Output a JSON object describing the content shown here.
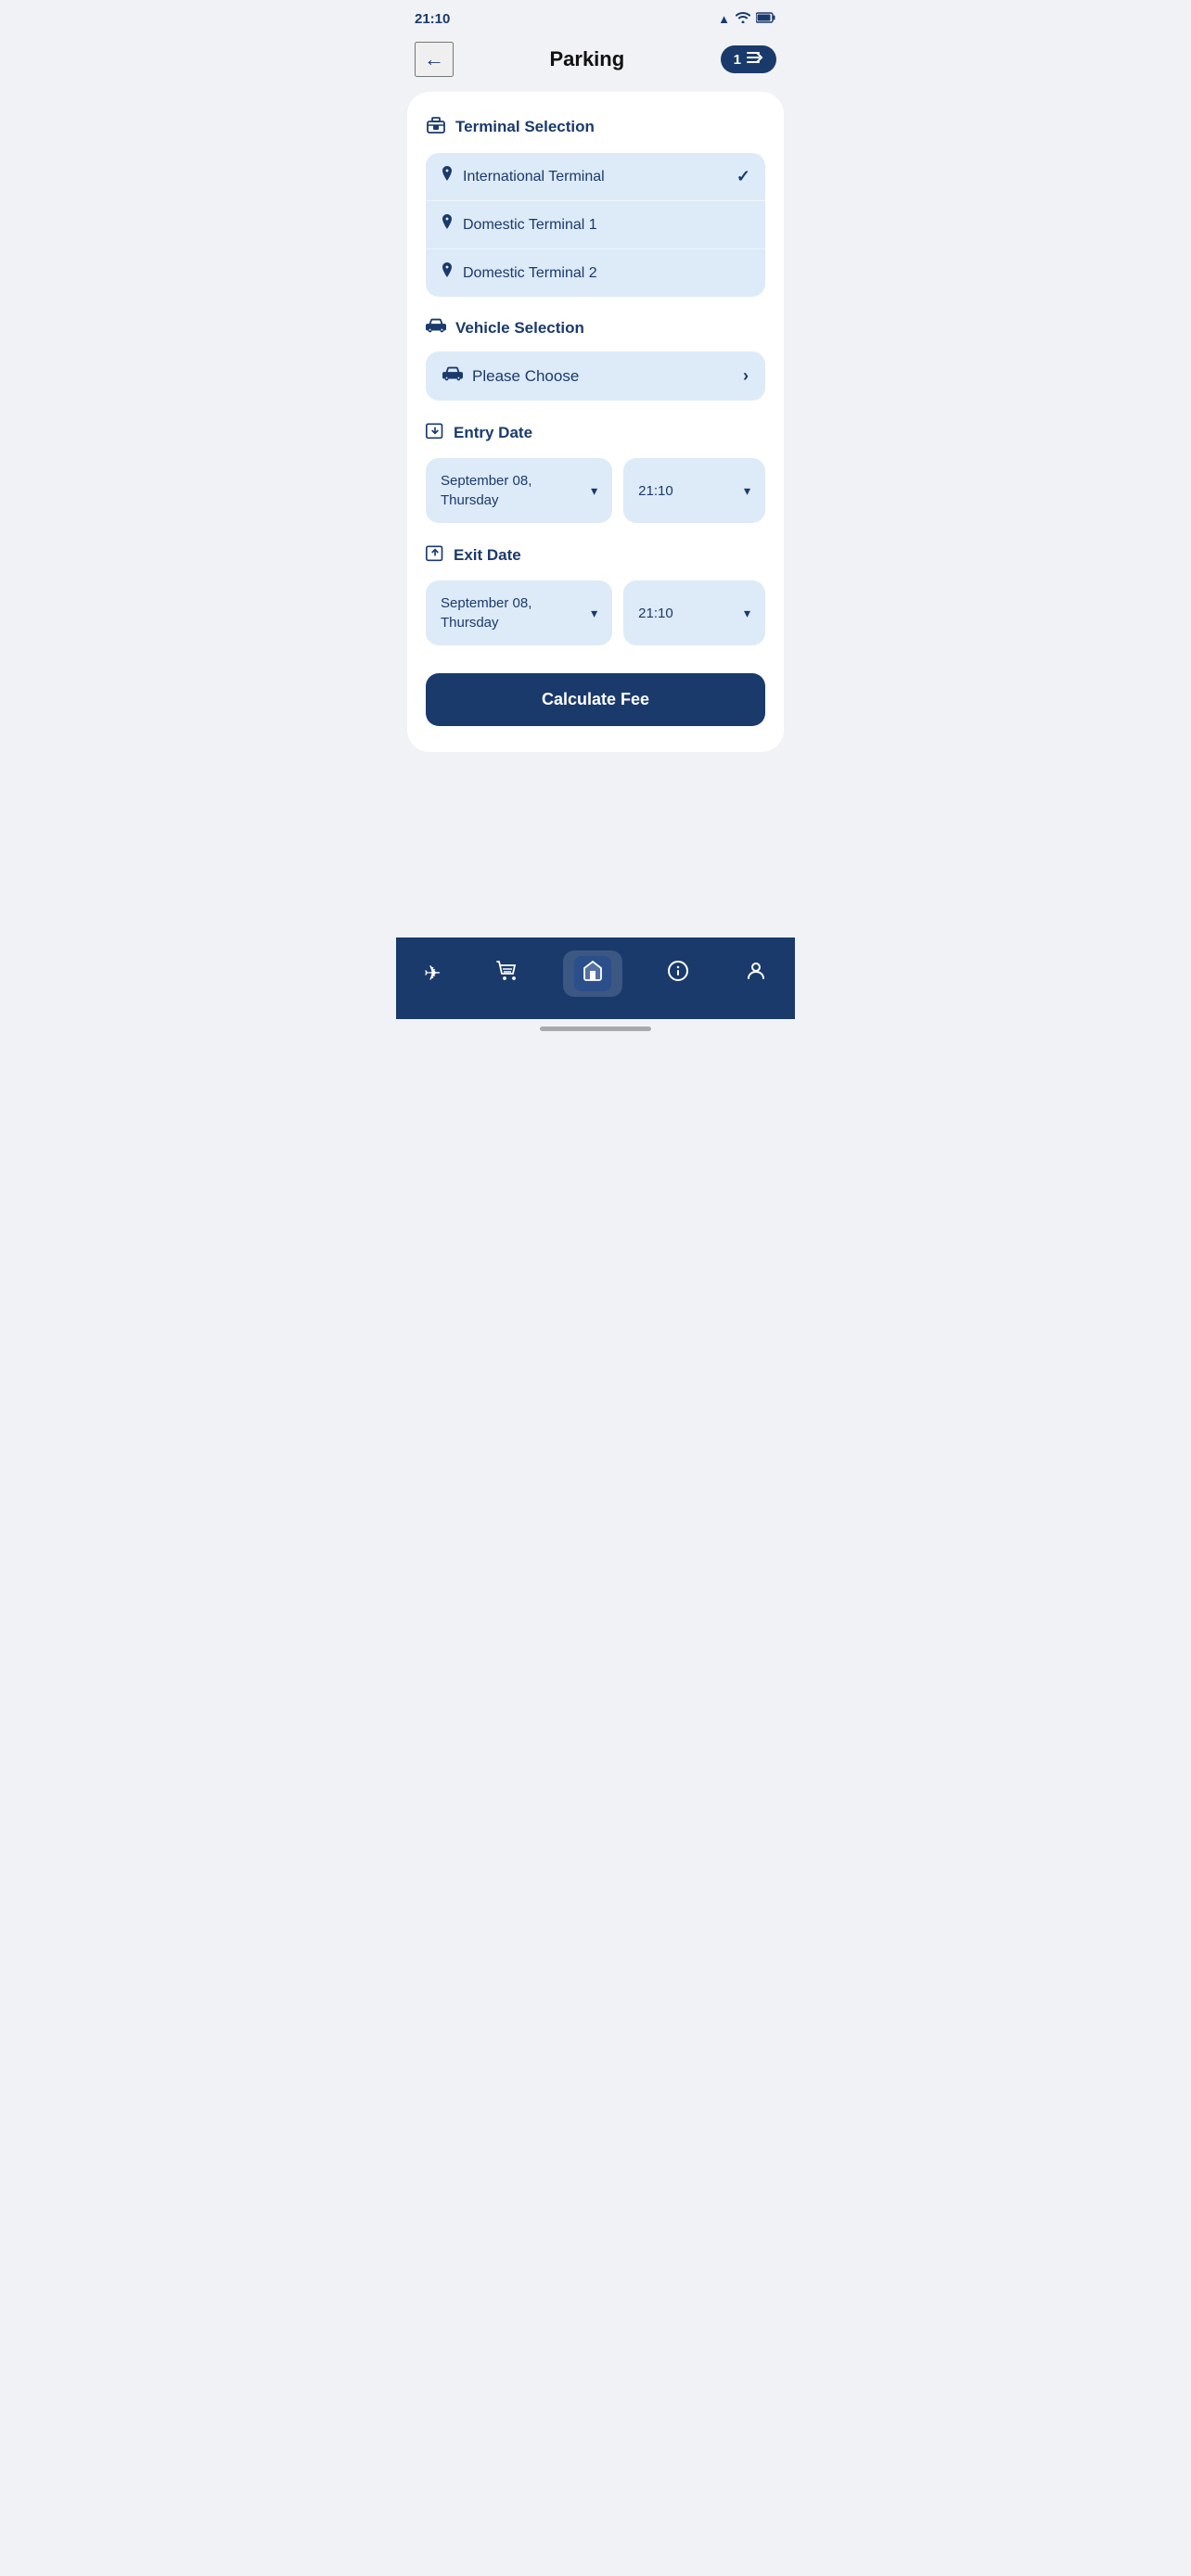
{
  "statusBar": {
    "time": "21:10",
    "signal": "▲",
    "wifi": "wifi",
    "battery": "battery"
  },
  "header": {
    "title": "Parking",
    "badge": "1",
    "badgeIcon": "→"
  },
  "terminalSection": {
    "label": "Terminal Selection",
    "icon": "🏛",
    "terminals": [
      {
        "name": "International Terminal",
        "selected": true
      },
      {
        "name": "Domestic Terminal 1",
        "selected": false
      },
      {
        "name": "Domestic Terminal 2",
        "selected": false
      }
    ]
  },
  "vehicleSection": {
    "label": "Vehicle Selection",
    "placeholder": "Please Choose"
  },
  "entryDateSection": {
    "label": "Entry Date",
    "date": "September 08,\nThursday",
    "time": "21:10"
  },
  "exitDateSection": {
    "label": "Exit Date",
    "date": "September 08,\nThursday",
    "time": "21:10"
  },
  "calculateButton": {
    "label": "Calculate Fee"
  },
  "bottomNav": {
    "items": [
      {
        "name": "flights",
        "icon": "✈"
      },
      {
        "name": "basket",
        "icon": "🛒"
      },
      {
        "name": "home",
        "icon": "⌂",
        "active": true
      },
      {
        "name": "info",
        "icon": "ℹ"
      },
      {
        "name": "profile",
        "icon": "👤"
      }
    ]
  }
}
